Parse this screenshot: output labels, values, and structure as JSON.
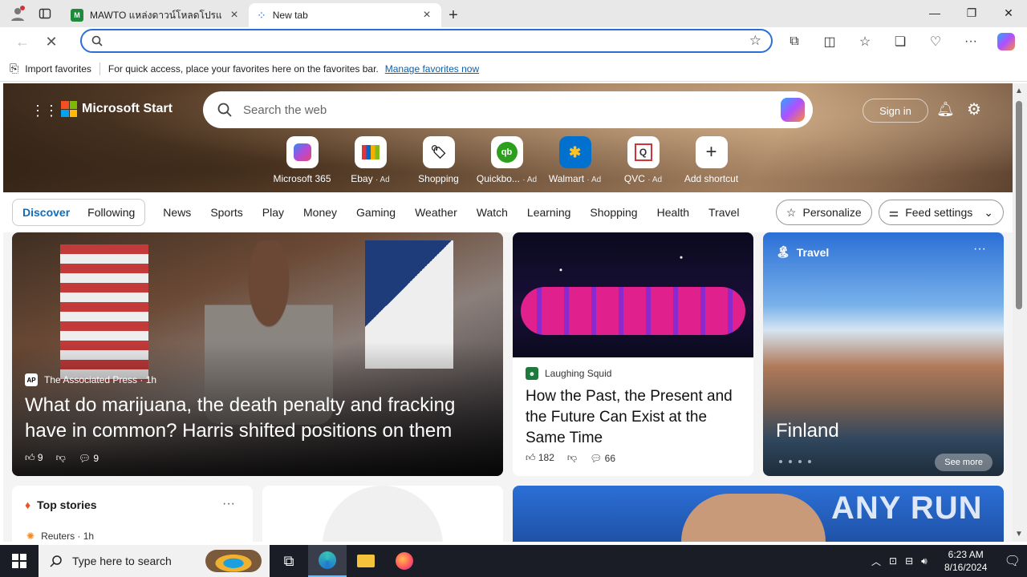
{
  "browser": {
    "tabs": [
      {
        "title": "MAWTO แหล่งดาวน์โหลดโปรแกรมฟรี",
        "active": false
      },
      {
        "title": "New tab",
        "active": true
      }
    ],
    "address_value": "",
    "favorites_bar": {
      "import_label": "Import favorites",
      "hint_text": "For quick access, place your favorites here on the favorites bar.",
      "manage_link": "Manage favorites now"
    }
  },
  "msn": {
    "brand": "Microsoft Start",
    "search_placeholder": "Search the web",
    "sign_in": "Sign in",
    "shortcuts": [
      {
        "label": "Microsoft 365",
        "ad": "",
        "icon": "microsoft-365-icon"
      },
      {
        "label": "Ebay",
        "ad": "· Ad",
        "icon": "ebay-icon"
      },
      {
        "label": "Shopping",
        "ad": "",
        "icon": "shopping-tag-icon"
      },
      {
        "label": "Quickbo...",
        "ad": "· Ad",
        "icon": "quickbooks-icon"
      },
      {
        "label": "Walmart",
        "ad": "· Ad",
        "icon": "walmart-icon"
      },
      {
        "label": "QVC",
        "ad": "· Ad",
        "icon": "qvc-icon"
      },
      {
        "label": "Add shortcut",
        "ad": "",
        "icon": "plus-icon"
      }
    ],
    "feed_tabs": [
      "Discover",
      "Following"
    ],
    "categories": [
      "News",
      "Sports",
      "Play",
      "Money",
      "Gaming",
      "Weather",
      "Watch",
      "Learning",
      "Shopping",
      "Health",
      "Travel"
    ],
    "personalize": "Personalize",
    "feed_settings": "Feed settings",
    "cards": {
      "main": {
        "source": "The Associated Press · 1h",
        "source_abbr": "AP",
        "headline": "What do marijuana, the death penalty and fracking have in common? Harris shifted positions on them",
        "likes": "9",
        "comments": "9"
      },
      "second": {
        "source": "Laughing Squid",
        "headline": "How the Past, the Present and the Future Can Exist at the Same Time",
        "likes": "182",
        "comments": "66"
      },
      "travel": {
        "label": "Travel",
        "place": "Finland",
        "see_more": "See more"
      },
      "top_stories": {
        "title": "Top stories",
        "source": "Reuters · 1h"
      }
    },
    "watermark": "ANY RUN"
  },
  "taskbar": {
    "search_placeholder": "Type here to search",
    "time": "6:23 AM",
    "date": "8/16/2024"
  },
  "colors": {
    "accent": "#0f6cbd",
    "omnibox_border": "#2b6fd6",
    "taskbar_bg": "#1a1c26"
  }
}
